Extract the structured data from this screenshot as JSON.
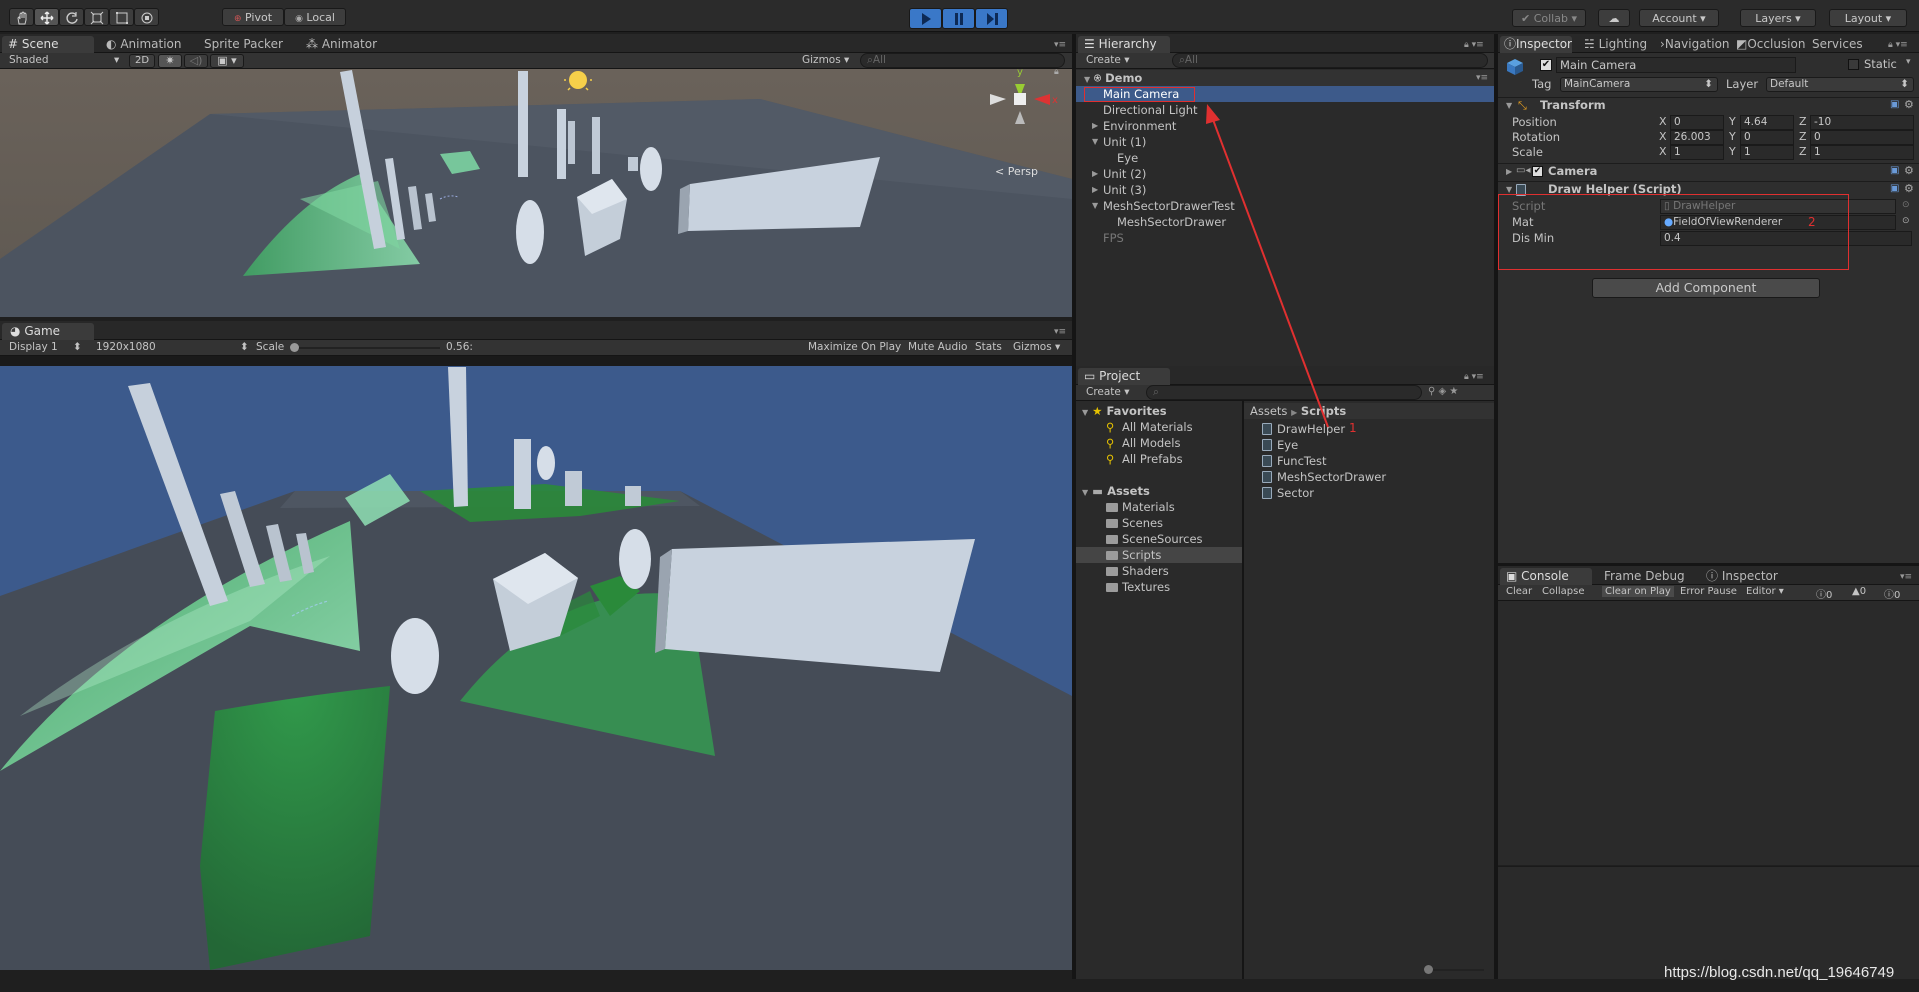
{
  "toolbar": {
    "pivot_label": "Pivot",
    "local_label": "Local",
    "collab_label": "Collab",
    "account_label": "Account",
    "layers_label": "Layers",
    "layout_label": "Layout"
  },
  "scene": {
    "tabs": [
      "Scene",
      "Animation",
      "Sprite Packer",
      "Animator"
    ],
    "shading_mode": "Shaded",
    "mode_2d": "2D",
    "gizmos_label": "Gizmos",
    "search_placeholder": "All",
    "persp_label": "Persp",
    "axis_y_label": "y"
  },
  "game": {
    "tab": "Game",
    "display": "Display 1",
    "resolution": "1920x1080",
    "scale_label": "Scale",
    "scale_value": "0.56:",
    "buttons": [
      "Maximize On Play",
      "Mute Audio",
      "Stats",
      "Gizmos"
    ]
  },
  "hierarchy": {
    "tab": "Hierarchy",
    "create_label": "Create",
    "search_placeholder": "All",
    "scene_name": "Demo",
    "items": [
      {
        "label": "Main Camera",
        "indent": 1,
        "arrow": "",
        "selected": true
      },
      {
        "label": "Directional Light",
        "indent": 1,
        "arrow": "",
        "selected": false
      },
      {
        "label": "Environment",
        "indent": 1,
        "arrow": "▶",
        "selected": false
      },
      {
        "label": "Unit (1)",
        "indent": 1,
        "arrow": "▼",
        "selected": false
      },
      {
        "label": "Eye",
        "indent": 2,
        "arrow": "",
        "selected": false
      },
      {
        "label": "Unit (2)",
        "indent": 1,
        "arrow": "▶",
        "selected": false
      },
      {
        "label": "Unit (3)",
        "indent": 1,
        "arrow": "▶",
        "selected": false
      },
      {
        "label": "MeshSectorDrawerTest",
        "indent": 1,
        "arrow": "▼",
        "selected": false
      },
      {
        "label": "MeshSectorDrawer",
        "indent": 2,
        "arrow": "",
        "selected": false
      },
      {
        "label": "FPS",
        "indent": 1,
        "arrow": "",
        "selected": false,
        "dim": true
      }
    ]
  },
  "project": {
    "tab": "Project",
    "create_label": "Create",
    "favorites_label": "Favorites",
    "favorites": [
      "All Materials",
      "All Models",
      "All Prefabs"
    ],
    "assets_label": "Assets",
    "folders": [
      "Materials",
      "Scenes",
      "SceneSources",
      "Scripts",
      "Shaders",
      "Textures"
    ],
    "selected_folder": "Scripts",
    "breadcrumb": [
      "Assets",
      "Scripts"
    ],
    "files": [
      "DrawHelper",
      "Eye",
      "FuncTest",
      "MeshSectorDrawer",
      "Sector"
    ],
    "annotation_1": "1"
  },
  "inspector": {
    "tabs": [
      "Inspector",
      "Lighting",
      "Navigation",
      "Occlusion",
      "Services"
    ],
    "object_name": "Main Camera",
    "static_label": "Static",
    "tag_label": "Tag",
    "tag_value": "MainCamera",
    "layer_label": "Layer",
    "layer_value": "Default",
    "transform": {
      "title": "Transform",
      "position_label": "Position",
      "rotation_label": "Rotation",
      "scale_label": "Scale",
      "position": {
        "x": "0",
        "y": "4.64",
        "z": "-10"
      },
      "rotation": {
        "x": "26.003",
        "y": "0",
        "z": "0"
      },
      "scale": {
        "x": "1",
        "y": "1",
        "z": "1"
      }
    },
    "camera_title": "Camera",
    "draw_helper": {
      "title": "Draw Helper (Script)",
      "script_label": "Script",
      "script_value": "DrawHelper",
      "mat_label": "Mat",
      "mat_value": "FieldOfViewRenderer",
      "dismin_label": "Dis Min",
      "dismin_value": "0.4",
      "annotation_2": "2"
    },
    "add_component_label": "Add Component"
  },
  "console": {
    "tabs": [
      "Console",
      "Frame Debug",
      "Inspector"
    ],
    "buttons": [
      "Clear",
      "Collapse",
      "Clear on Play",
      "Error Pause",
      "Editor"
    ],
    "counts": {
      "log": "0",
      "warn": "0",
      "error": "0"
    }
  },
  "watermark": "https://blog.csdn.net/qq_19646749",
  "colors": {
    "selection": "#3d5a8a",
    "annotation_red": "#e03030",
    "play_blue": "#3a78c8",
    "ground": "#4a525e",
    "sky": "#3c5a8c",
    "fov_green": "#38b060"
  }
}
